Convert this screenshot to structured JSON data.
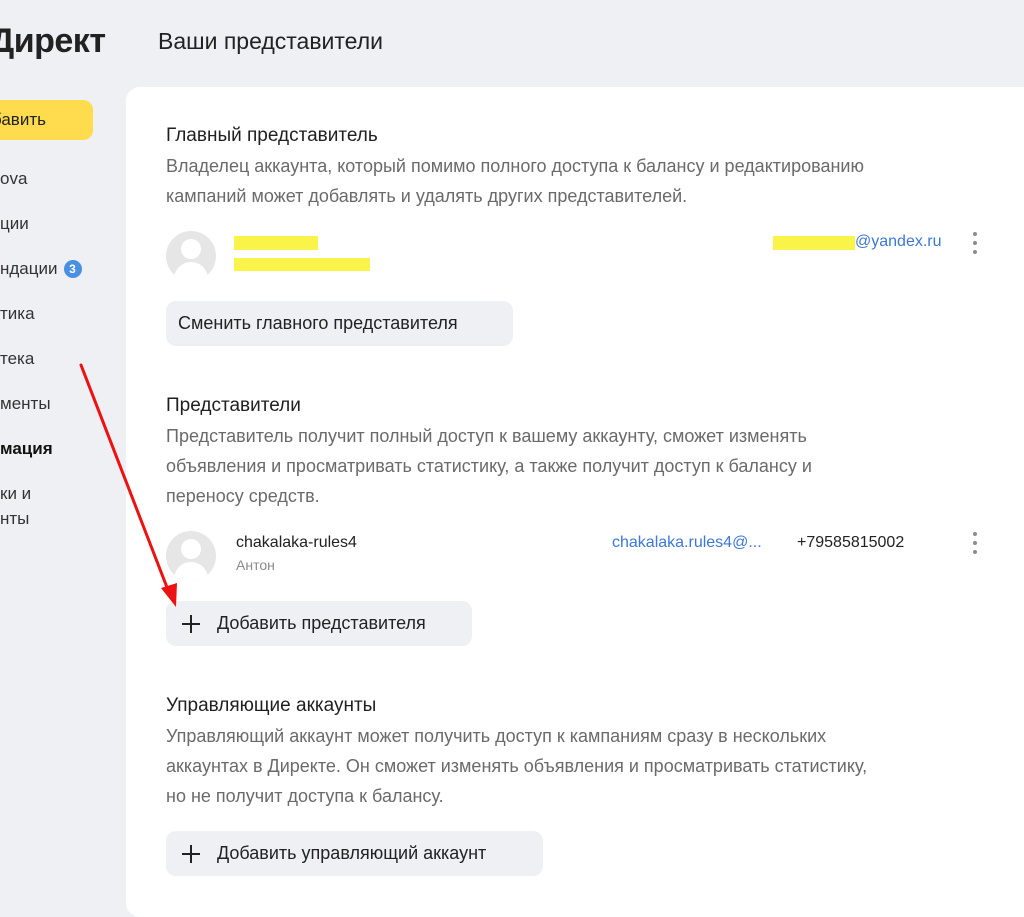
{
  "sidebar": {
    "logo": "Директ",
    "add_button": "бавить",
    "items": [
      {
        "label": "ova"
      },
      {
        "label": "ции"
      },
      {
        "label": "ндации",
        "badge": "3"
      },
      {
        "label": "тика"
      },
      {
        "label": "тека"
      },
      {
        "label": "менты"
      },
      {
        "label": "мация",
        "active": true
      },
      {
        "label": "ки и"
      },
      {
        "label": "нты"
      }
    ]
  },
  "page": {
    "title": "Ваши представители"
  },
  "main_rep": {
    "title": "Главный представитель",
    "desc_line1": "Владелец аккаунта, который помимо полного доступа к балансу и редактированию",
    "desc_line2": "кампаний может добавлять и удалять других представителей.",
    "email_suffix": "@yandex.ru",
    "change_button": "Сменить главного представителя"
  },
  "reps": {
    "title": "Представители",
    "desc_line1": "Представитель получит полный доступ к вашему аккаунту, сможет изменять",
    "desc_line2": "объявления и просматривать статистику, а также получит доступ к балансу и",
    "desc_line3": "переносу средств.",
    "items": [
      {
        "login": "chakalaka-rules4",
        "name": "Антон",
        "email": "chakalaka.rules4@...",
        "phone": "+79585815002"
      }
    ],
    "add_button": "Добавить представителя"
  },
  "agency": {
    "title": "Управляющие аккаунты",
    "desc_line1": "Управляющий аккаунт может получить доступ к кампаниям сразу в нескольких",
    "desc_line2": "аккаунтах в Директе. Он сможет изменять объявления и просматривать статистику,",
    "desc_line3": "но не получит доступа к балансу.",
    "add_button": "Добавить управляющий аккаунт"
  },
  "colors": {
    "accent_yellow": "#ffdb4d",
    "link_blue": "#3b78d8",
    "annotation_arrow": "#ee1111",
    "redaction": "#f9f34a"
  }
}
